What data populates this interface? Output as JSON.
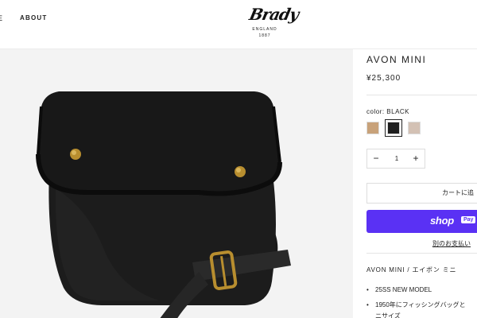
{
  "header": {
    "nav_cut_label": "E",
    "nav_about_label": "ABOUT",
    "logo": {
      "script": "Brady",
      "sub": "ENGLAND",
      "year": "1887"
    }
  },
  "product": {
    "title": "AVON MINI",
    "price": "¥25,300",
    "color_label": "color: BLACK",
    "swatches": [
      {
        "name": "tan",
        "color": "#c8a27a",
        "selected": false
      },
      {
        "name": "black",
        "color": "#1e1e1e",
        "selected": true
      },
      {
        "name": "beige",
        "color": "#d3c1b4",
        "selected": false
      }
    ],
    "quantity": {
      "minus": "−",
      "value": "1",
      "plus": "+"
    },
    "add_to_cart_label": "カートに追",
    "shop_pay": {
      "shop": "shop",
      "pay": "Pay"
    },
    "other_payment_label": "別のお支払い",
    "description_title": "AVON MINI / エイボン ミニ",
    "bullets": [
      "25SS NEW MODEL",
      "1950年にフィッシングバッグと"
    ],
    "bullet_cont": "ニサイズ"
  },
  "colors": {
    "accent_shoppay": "#5a31f4",
    "image_bg": "#f3f3f3",
    "bag": "#1b1b1b",
    "rivet": "#b88e2f"
  }
}
